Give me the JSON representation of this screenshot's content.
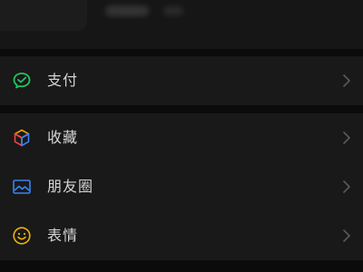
{
  "me_page": {
    "menu_items": [
      {
        "label": "支付",
        "icon": "wechat-pay-icon"
      },
      {
        "label": "收藏",
        "icon": "favorites-cube-icon"
      },
      {
        "label": "朋友圈",
        "icon": "moments-image-icon"
      },
      {
        "label": "表情",
        "icon": "sticker-smiley-icon"
      }
    ]
  },
  "colors": {
    "pay_green": "#22c55e",
    "moments_blue": "#3b82f6",
    "sticker_yellow": "#eab308",
    "label": "#d6d6d6",
    "chevron": "#5a5a5a"
  }
}
